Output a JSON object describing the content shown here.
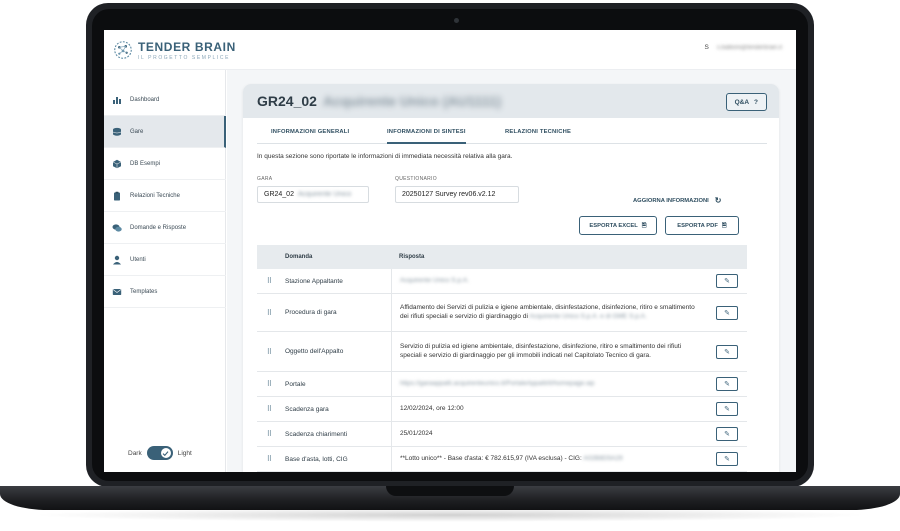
{
  "app": {
    "logo_title": "TENDER BRAIN",
    "logo_subtitle": "IL PROGETTO SEMPLICE",
    "user_initial": "S",
    "user_email": "s.balboni@tenderbrain.it"
  },
  "sidebar": {
    "items": [
      {
        "label": "Dashboard",
        "icon": "bar-chart-icon",
        "active": false
      },
      {
        "label": "Gare",
        "icon": "database-icon",
        "active": true
      },
      {
        "label": "DB Esempi",
        "icon": "cube-icon",
        "active": false
      },
      {
        "label": "Relazioni Tecniche",
        "icon": "clipboard-icon",
        "active": false
      },
      {
        "label": "Domande e Risposte",
        "icon": "chat-icon",
        "active": false
      },
      {
        "label": "Utenti",
        "icon": "user-icon",
        "active": false
      },
      {
        "label": "Templates",
        "icon": "mail-icon",
        "active": false
      }
    ],
    "theme": {
      "dark_label": "Dark",
      "light_label": "Light",
      "state": "light"
    }
  },
  "gara": {
    "code": "GR24_02",
    "title_obscured": "Acquirente Unico (AU1111)",
    "qa_label": "Q&A",
    "qa_icon": "?"
  },
  "tabs": [
    {
      "label": "INFORMAZIONI GENERALI",
      "active": false
    },
    {
      "label": "INFORMAZIONI DI SINTESI",
      "active": true
    },
    {
      "label": "RELAZIONI TECNICHE",
      "active": false
    }
  ],
  "section": {
    "description": "In questa sezione sono riportate le informazioni di immediata necessità relativa alla gara.",
    "gara_label": "GARA",
    "gara_value": "GR24_02",
    "gara_value_obscured": "Acquirente Unico",
    "questionario_label": "QUESTIONARIO",
    "questionario_value": "20250127 Survey rev06.v2.12",
    "refresh_label": "AGGIORNA INFORMAZIONI",
    "export_excel": "ESPORTA EXCEL",
    "export_pdf": "ESPORTA PDF"
  },
  "table": {
    "headers": [
      "Domanda",
      "Risposta"
    ],
    "rows": [
      {
        "domanda": "Stazione Appaltante",
        "risposta": "",
        "obscured": "Acquirente Unico S.p.A."
      },
      {
        "domanda": "Procedura di gara",
        "risposta": "Affidamento dei Servizi di pulizia e igiene ambientale, disinfestazione, disinfezione, ritiro e smaltimento dei rifiuti speciali e servizio di giardinaggio di",
        "obscured": "Acquirente Unico S.p.A. e di GME S.p.A."
      },
      {
        "domanda": "Oggetto dell'Appalto",
        "risposta": "Servizio di pulizia ed igiene ambientale, disinfestazione, disinfezione, ritiro e smaltimento dei rifiuti speciali e servizio di giardinaggio per gli immobili indicati nel Capitolato Tecnico di gara.",
        "obscured": ""
      },
      {
        "domanda": "Portale",
        "risposta": "",
        "obscured": "https://garaappalti.acquirenteunico.it/PortaleAppalti/it/homepage.wp"
      },
      {
        "domanda": "Scadenza gara",
        "risposta": "12/02/2024, ore 12:00",
        "obscured": ""
      },
      {
        "domanda": "Scadenza chiarimenti",
        "risposta": "25/01/2024",
        "obscured": ""
      },
      {
        "domanda": "Base d'asta, lotti, CIG",
        "risposta": "**Lotto unico** - Base d'asta: € 782.615,97 (IVA esclusa) - CIG:",
        "obscured": "A02B8D5A29"
      }
    ]
  },
  "colors": {
    "accent": "#3a6178",
    "header_bg": "#e3e8ec",
    "page_bg": "#f4f6f8"
  }
}
